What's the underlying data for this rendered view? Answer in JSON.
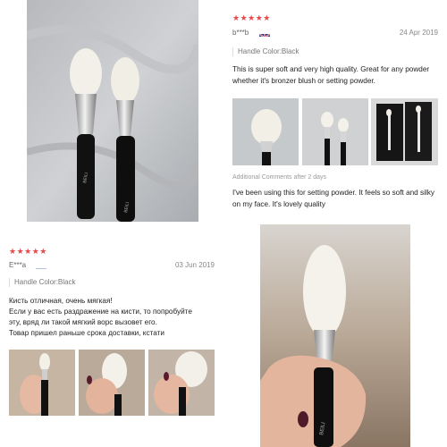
{
  "review1": {
    "stars": "★★★★★",
    "user": "b***b",
    "date": "24 Apr 2019",
    "handle": "Handle Color:Black",
    "text": "This is super soft and very high quality. Great for any powder whether it's bronzer blush or setting powder.",
    "additional_label": "Additional Comments after 2 days",
    "additional_text": "I've been using this for setting powder. It feels so soft and silky on my face. It's lovely quality"
  },
  "review2": {
    "stars": "★★★★★",
    "user": "E***a",
    "date": "03 Jun 2019",
    "handle": "Handle Color:Black",
    "text_line1": "Кисть отличная, очень мягкая!",
    "text_line2": "Если у вас есть раздражение на кисти, то попробуйте",
    "text_line3": "эту, вряд ли такой мягкий ворс вызовет его.",
    "text_line4": "Товар пришел раньше срока доставки, кстати"
  },
  "brand_mark": "BEILI",
  "colors": {
    "star": "#e8474b",
    "handle": "#111111",
    "ferrule": "#c9c9c9",
    "bristle": "#f4f1ea"
  }
}
